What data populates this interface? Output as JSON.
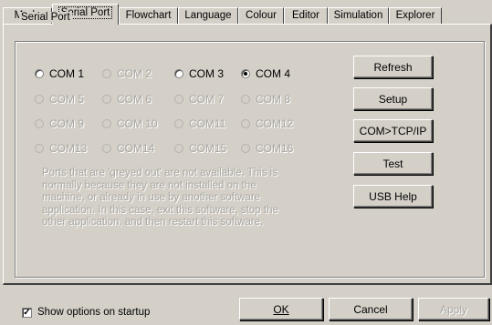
{
  "tabs": [
    "Mode",
    "Serial Port",
    "Flowchart",
    "Language",
    "Colour",
    "Editor",
    "Simulation",
    "Explorer"
  ],
  "active_tab": "Serial Port",
  "group_title": "Serial Port",
  "ports": [
    {
      "label": "COM 1",
      "enabled": true,
      "selected": false
    },
    {
      "label": "COM 2",
      "enabled": false,
      "selected": false
    },
    {
      "label": "COM 3",
      "enabled": true,
      "selected": false
    },
    {
      "label": "COM 4",
      "enabled": true,
      "selected": true
    },
    {
      "label": "COM 5",
      "enabled": false,
      "selected": false
    },
    {
      "label": "COM 6",
      "enabled": false,
      "selected": false
    },
    {
      "label": "COM 7",
      "enabled": false,
      "selected": false
    },
    {
      "label": "COM 8",
      "enabled": false,
      "selected": false
    },
    {
      "label": "COM 9",
      "enabled": false,
      "selected": false
    },
    {
      "label": "COM 10",
      "enabled": false,
      "selected": false
    },
    {
      "label": "COM11",
      "enabled": false,
      "selected": false
    },
    {
      "label": "COM12",
      "enabled": false,
      "selected": false
    },
    {
      "label": "COM13",
      "enabled": false,
      "selected": false
    },
    {
      "label": "COM14",
      "enabled": false,
      "selected": false
    },
    {
      "label": "COM15",
      "enabled": false,
      "selected": false
    },
    {
      "label": "COM16",
      "enabled": false,
      "selected": false
    }
  ],
  "note": "Ports that are 'greyed out' are not available. This is normally because they are not installed on the machine, or already in use by another software application. In this case, exit this software, stop the other application, and then restart this software.",
  "side_buttons": {
    "refresh": "Refresh",
    "setup": "Setup",
    "com_tcpip": "COM>TCP/IP",
    "test": "Test",
    "usb_help": "USB Help"
  },
  "footer": {
    "show_options_label": "Show options on startup",
    "show_options_checked": true,
    "checkmark": "✓",
    "ok": "OK",
    "cancel": "Cancel",
    "apply": "Apply"
  }
}
